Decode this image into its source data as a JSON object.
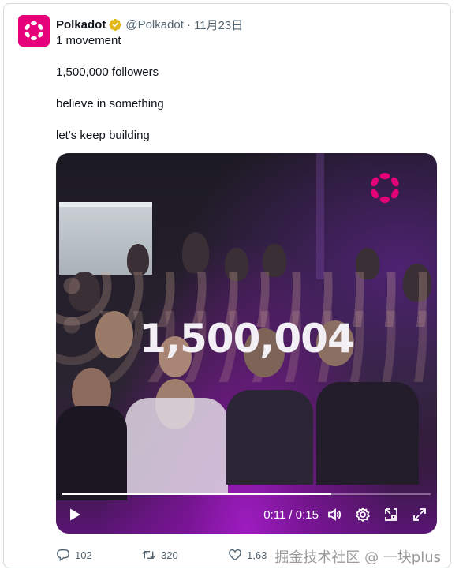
{
  "tweet": {
    "author_name": "Polkadot",
    "author_handle": "@Polkadot",
    "separator": "·",
    "date": "11月23日",
    "lines": [
      "1 movement",
      "1,500,000 followers",
      "believe in something",
      "let's keep building"
    ]
  },
  "video": {
    "overlay_number": "1,500,004",
    "time_display": "0:11 / 0:15",
    "progress_fraction": 0.73
  },
  "actions": {
    "replies": "102",
    "reposts": "320",
    "likes": "1,63"
  },
  "watermark": "掘金技术社区 @ 一块plus",
  "colors": {
    "brand": "#e6007a",
    "verified": "#e2b719",
    "text_secondary": "#536471"
  },
  "icons": [
    "polkadot-logo-icon",
    "verified-badge-icon",
    "play-icon",
    "volume-icon",
    "settings-icon",
    "popout-icon",
    "fullscreen-icon",
    "reply-icon",
    "repost-icon",
    "like-icon"
  ]
}
